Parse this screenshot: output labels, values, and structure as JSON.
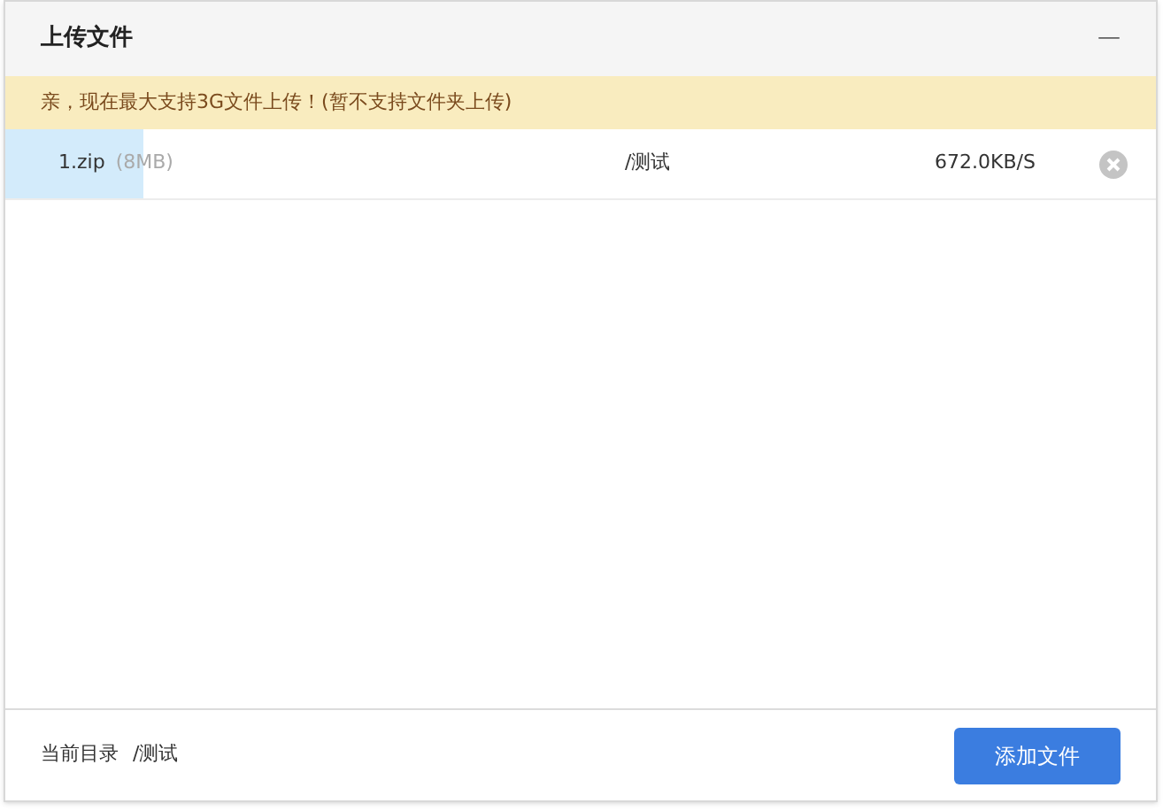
{
  "window": {
    "title": "上传文件",
    "minimize": "—"
  },
  "notice": "亲，现在最大支持3G文件上传！(暂不支持文件夹上传)",
  "files": [
    {
      "name": "1.zip",
      "size": "(8MB)",
      "path": "/测试",
      "speed": "672.0KB/S",
      "level": 0.12
    }
  ],
  "footer": {
    "label": "当前目录",
    "path": "/测试",
    "button": "添加文件"
  }
}
